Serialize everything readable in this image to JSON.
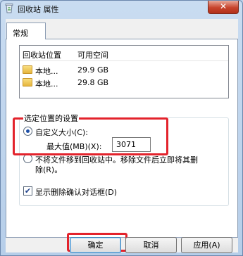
{
  "window": {
    "title": "回收站 属性",
    "close_glyph": "✕"
  },
  "tabs": [
    {
      "label": "常规"
    }
  ],
  "locations": {
    "headers": [
      "回收站位置",
      "可用空间"
    ],
    "rows": [
      {
        "location": "本地...",
        "free": "29.9 GB"
      },
      {
        "location": "本地...",
        "free": "29.8 GB"
      }
    ]
  },
  "settings": {
    "group_title": "选定位置的设置",
    "custom_size_label": "自定义大小(C):",
    "max_label": "最大值(MB)(X):",
    "max_value": "3071",
    "no_move_line1": "不将文件移到回收站中。移除文件后立即将其删",
    "no_move_line2": "除(R)。",
    "confirm_label": "显示删除确认对话框(D)",
    "custom_size_selected": true,
    "confirm_checked": true,
    "check_glyph": "✔"
  },
  "buttons": {
    "ok": "确定",
    "cancel": "取消",
    "apply": "应用(A)"
  },
  "colors": {
    "highlight": "#e3232c",
    "title_bg": "#bcd3ec"
  }
}
